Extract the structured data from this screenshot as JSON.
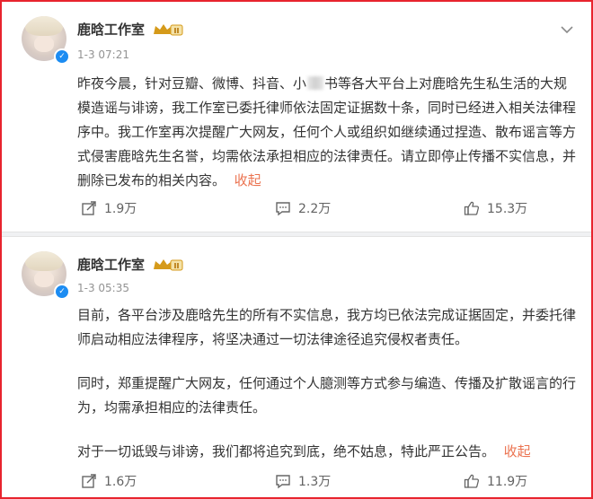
{
  "posts": [
    {
      "author": "鹿晗工作室",
      "time": "1-3 07:21",
      "paragraphs": [
        "昨夜今晨，针对豆瓣、微博、抖音、小"
      ],
      "text_after_blur": "书等各大平台上对鹿晗先生私生活的大规模造谣与诽谤，我工作室已委托律师依法固定证据数十条，同时已经进入相关法律程序中。我工作室再次提醒广大网友，任何个人或组织如继续通过捏造、散布谣言等方式侵害鹿晗先生名誉，均需依法承担相应的法律责任。请立即停止传播不实信息，并删除已发布的相关内容。",
      "collapse_label": "收起",
      "shares": "1.9万",
      "comments": "2.2万",
      "likes": "15.3万"
    },
    {
      "author": "鹿晗工作室",
      "time": "1-3 05:35",
      "paragraphs": [
        "目前，各平台涉及鹿晗先生的所有不实信息，我方均已依法完成证据固定，并委托律师启动相应法律程序，将坚决通过一切法律途径追究侵权者责任。",
        "同时，郑重提醒广大网友，任何通过个人臆测等方式参与编造、传播及扩散谣言的行为，均需承担相应的法律责任。",
        "对于一切诋毁与诽谤，我们都将追究到底，绝不姑息，特此严正公告。"
      ],
      "collapse_label": "收起",
      "shares": "1.6万",
      "comments": "1.3万",
      "likes": "11.9万"
    }
  ],
  "icons": {
    "share": "share-icon",
    "comment": "comment-icon",
    "like": "like-icon",
    "menu": "chevron-down-icon",
    "verified": "verified-icon",
    "badge": "crown-badge-icon"
  },
  "colors": {
    "frame_border": "#e8242e",
    "collapse_link": "#eb7350",
    "verified": "#1c8cf2",
    "badge": "#d59a1a"
  }
}
